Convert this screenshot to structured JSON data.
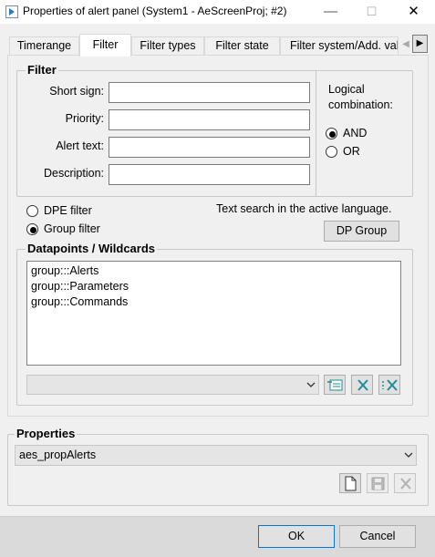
{
  "window": {
    "title": "Properties of alert panel (System1 - AeScreenProj; #2)",
    "minimize": "—",
    "maximize": "☐",
    "close": "✕"
  },
  "tabs": [
    {
      "label": "Timerange"
    },
    {
      "label": "Filter",
      "active": true
    },
    {
      "label": "Filter types"
    },
    {
      "label": "Filter state"
    },
    {
      "label": "Filter system/Add. valu"
    }
  ],
  "tab_scroll": {
    "left": "◀",
    "right": "▶"
  },
  "filter_group": {
    "title": "Filter",
    "fields": [
      {
        "label": "Short sign:",
        "value": ""
      },
      {
        "label": "Priority:",
        "value": ""
      },
      {
        "label": "Alert text:",
        "value": ""
      },
      {
        "label": "Description:",
        "value": ""
      }
    ],
    "logical_label_1": "Logical",
    "logical_label_2": "combination:",
    "logic_options": [
      {
        "label": "AND",
        "selected": true
      },
      {
        "label": "OR",
        "selected": false
      }
    ]
  },
  "filter_mode": {
    "options": [
      {
        "label": "DPE filter",
        "selected": false
      },
      {
        "label": "Group filter",
        "selected": true
      }
    ],
    "search_note": "Text search in the active language.",
    "dp_group_button": "DP Group"
  },
  "datapoints_group": {
    "title": "Datapoints / Wildcards",
    "items": [
      "group:::Alerts",
      "group:::Parameters",
      "group:::Commands"
    ],
    "combo_value": ""
  },
  "properties_group": {
    "title": "Properties",
    "combo_value": "aes_propAlerts"
  },
  "dialog_buttons": {
    "ok": "OK",
    "cancel": "Cancel"
  },
  "colors": {
    "accent": "#0078d7",
    "icon_teal": "#1e8c9a"
  }
}
